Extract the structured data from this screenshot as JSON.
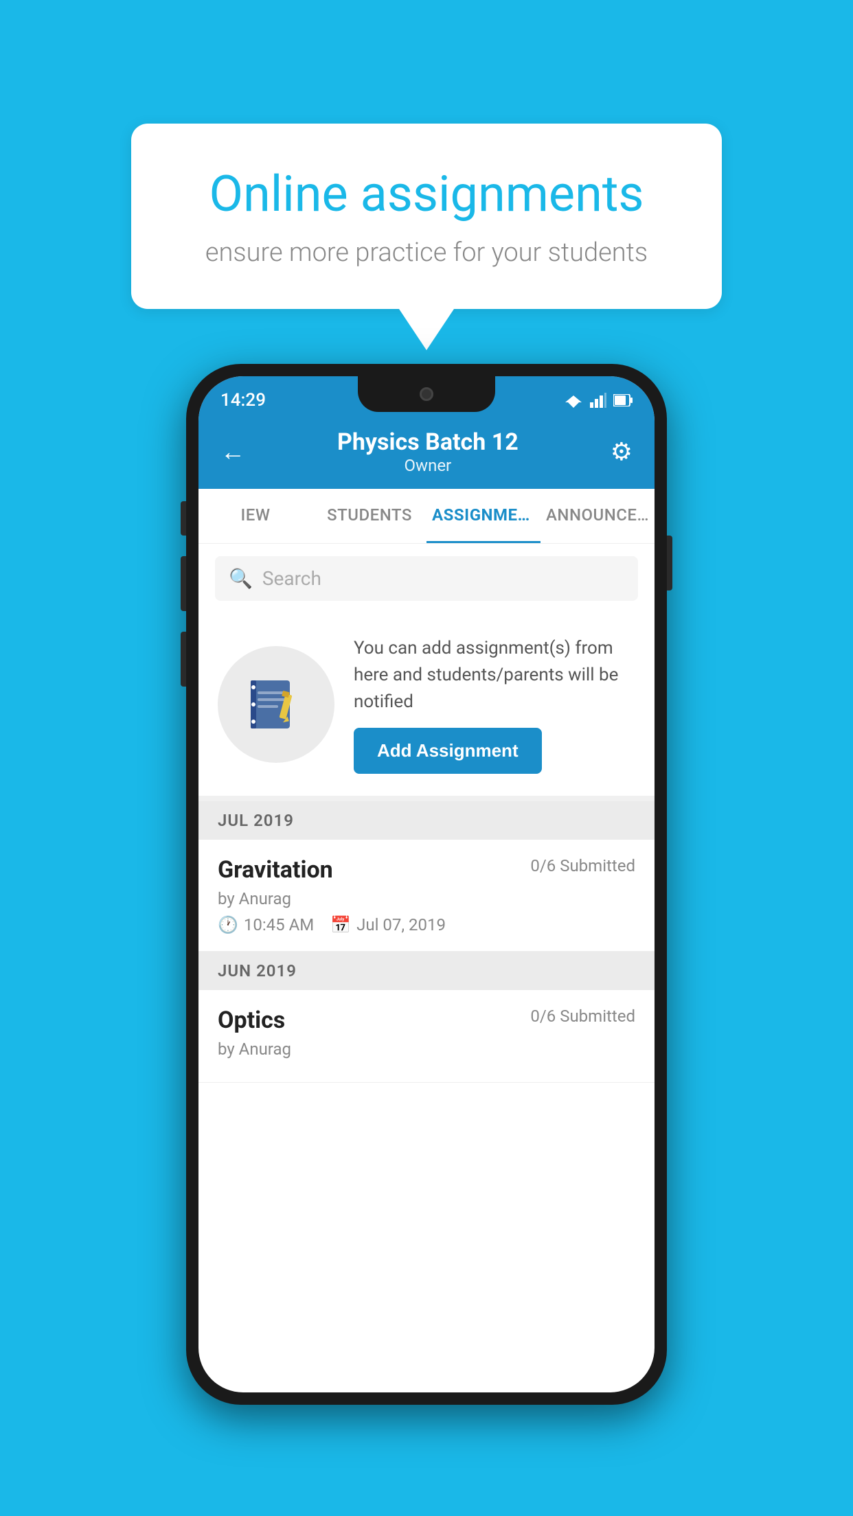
{
  "background_color": "#1ab8e8",
  "speech_bubble": {
    "title": "Online assignments",
    "subtitle": "ensure more practice for your students"
  },
  "status_bar": {
    "time": "14:29"
  },
  "app_header": {
    "title": "Physics Batch 12",
    "subtitle": "Owner"
  },
  "tabs": [
    {
      "label": "IEW",
      "active": false
    },
    {
      "label": "STUDENTS",
      "active": false
    },
    {
      "label": "ASSIGNMENTS",
      "active": true
    },
    {
      "label": "ANNOUNCEM...",
      "active": false
    }
  ],
  "search": {
    "placeholder": "Search"
  },
  "add_assignment": {
    "description": "You can add assignment(s) from here and students/parents will be notified",
    "button_label": "Add Assignment"
  },
  "sections": [
    {
      "header": "JUL 2019",
      "assignments": [
        {
          "name": "Gravitation",
          "submitted": "0/6 Submitted",
          "by": "by Anurag",
          "time": "10:45 AM",
          "date": "Jul 07, 2019"
        }
      ]
    },
    {
      "header": "JUN 2019",
      "assignments": [
        {
          "name": "Optics",
          "submitted": "0/6 Submitted",
          "by": "by Anurag",
          "time": "",
          "date": ""
        }
      ]
    }
  ],
  "icons": {
    "back_arrow": "←",
    "gear": "⚙",
    "search": "🔍",
    "clock": "🕐",
    "calendar": "📅"
  }
}
